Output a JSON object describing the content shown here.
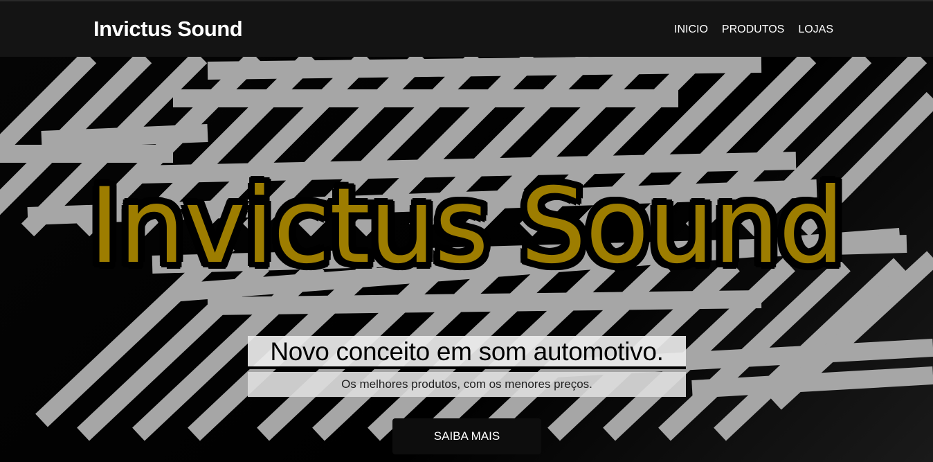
{
  "header": {
    "brand": "Invictus Sound",
    "nav": [
      "INICIO",
      "PRODUTOS",
      "LOJAS"
    ]
  },
  "hero": {
    "title": "Invictus Sound",
    "subtitle": "Novo conceito em som automotivo.",
    "tagline": "Os melhores produtos, com os menores preços.",
    "cta_label": "SAIBA MAIS"
  },
  "colors": {
    "header_bg": "#141414",
    "hero_bg": "#000000",
    "title_gold": "#9d7d00",
    "stripes": "#a6a6a6"
  }
}
